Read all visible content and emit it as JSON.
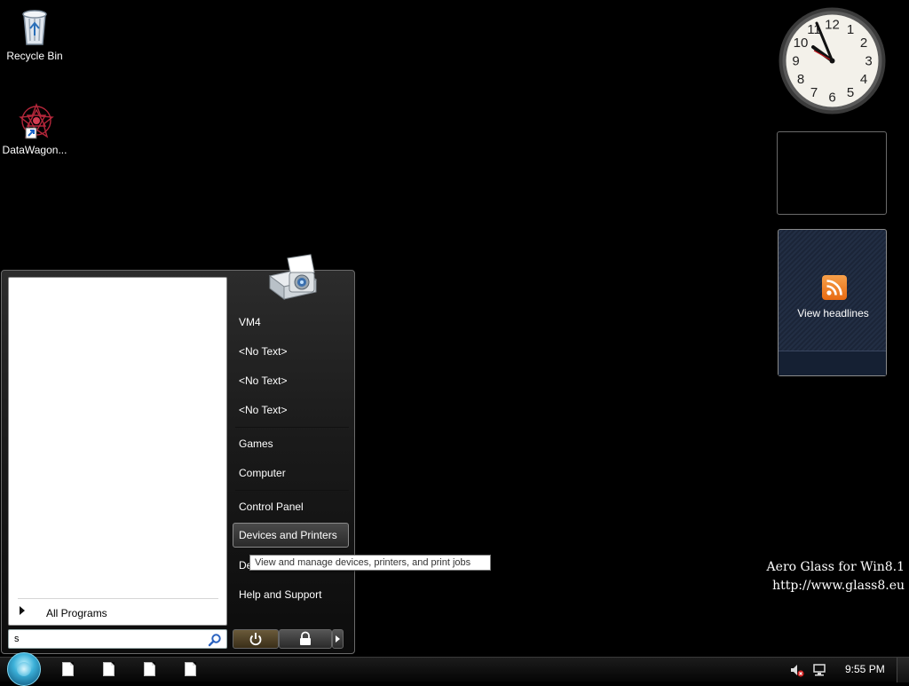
{
  "desktop": {
    "icons": [
      {
        "label": "Recycle Bin",
        "icon": "recycle-bin-icon"
      },
      {
        "label": "DataWagon...",
        "icon": "datawagon-shortcut-icon"
      }
    ]
  },
  "start_menu": {
    "all_programs": "All Programs",
    "search_value": "s",
    "right_items": [
      {
        "label": "VM4"
      },
      {
        "label": "<No Text>"
      },
      {
        "label": "<No Text>"
      },
      {
        "label": "<No Text>"
      },
      {
        "label": "Games"
      },
      {
        "label": "Computer"
      },
      {
        "label": "Control Panel"
      },
      {
        "label": "Devices and Printers"
      },
      {
        "label": "De"
      },
      {
        "label": "Help and Support"
      }
    ],
    "tooltip": "View and manage devices, printers, and print jobs"
  },
  "gadgets": {
    "clock_numbers": [
      "12",
      "1",
      "2",
      "3",
      "4",
      "5",
      "6",
      "7",
      "8",
      "9",
      "10",
      "11"
    ],
    "feed_label": "View headlines"
  },
  "watermark": {
    "line1": "Aero Glass for Win8.1",
    "line2": "http://www.glass8.eu"
  },
  "taskbar": {
    "time": "9:55 PM"
  },
  "colors": {
    "desktop_bg": "#000000",
    "rss_orange": "#f08a24",
    "orb_blue": "#3bb0d8"
  }
}
